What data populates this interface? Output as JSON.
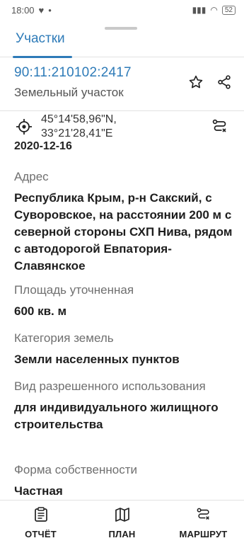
{
  "status_bar": {
    "time": "18:00",
    "battery": "52"
  },
  "header": {
    "tab_label": "Участки",
    "cadastral_number": "90:11:210102:2417",
    "object_type": "Земельный участок"
  },
  "coordinates": {
    "lat": "45°14'58,96\"N,",
    "lon": "33°21'28,41\"E"
  },
  "details": {
    "date": "2020-12-16",
    "fields": [
      {
        "label": "Адрес",
        "value": "Республика Крым, р-н Сакский, с Суворовское, на расстоянии 200 м с северной стороны СХП Нива, рядом с автодорогой Евпатория-Славянское"
      },
      {
        "label": "Площадь уточненная",
        "value": "600 кв. м"
      },
      {
        "label": "Категория земель",
        "value": "Земли населенных пунктов"
      },
      {
        "label": "Вид разрешенного использования",
        "value": "для индивидуального жилищного строительства"
      },
      {
        "label": "Форма собственности",
        "value": "Частная"
      }
    ]
  },
  "bottom_nav": [
    {
      "label": "ОТЧЁТ",
      "icon": "report-icon"
    },
    {
      "label": "ПЛАН",
      "icon": "map-icon"
    },
    {
      "label": "МАРШРУТ",
      "icon": "route-icon"
    }
  ]
}
